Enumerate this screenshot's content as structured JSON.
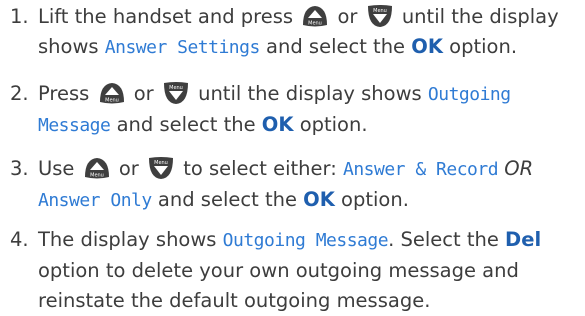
{
  "steps": [
    {
      "num": "1.",
      "text_a": "Lift the handset and press",
      "or": "or",
      "text_b": "until the display",
      "text_c": "shows",
      "lcd1": "Answer Settings",
      "text_d": "and select the",
      "ok": "OK",
      "text_e": "option."
    },
    {
      "num": "2.",
      "text_a": "Press",
      "or": "or",
      "text_b": "until the display shows",
      "lcd1": "Outgoing",
      "lcd2": "Message",
      "text_c": "and select the",
      "ok": "OK",
      "text_d": "option."
    },
    {
      "num": "3.",
      "text_a": "Use",
      "or": "or",
      "text_b": "to select either:",
      "lcd1": "Answer & Record",
      "or_italic": "OR",
      "lcd2": "Answer Only",
      "text_c": "and select the",
      "ok": "OK",
      "text_d": "option."
    },
    {
      "num": "4.",
      "text_a": "The display shows",
      "lcd1": "Outgoing Message",
      "text_b": ". Select the",
      "del": "Del",
      "text_c": "option to delete your own outgoing message and",
      "text_d": "reinstate the default outgoing message."
    }
  ],
  "keys": {
    "up_key_label": "Menu",
    "down_key_label": "Menu",
    "up_icon": "up-arrow-menu-key-icon",
    "down_icon": "down-arrow-menu-key-icon",
    "key_color": "#3f3f3f"
  }
}
